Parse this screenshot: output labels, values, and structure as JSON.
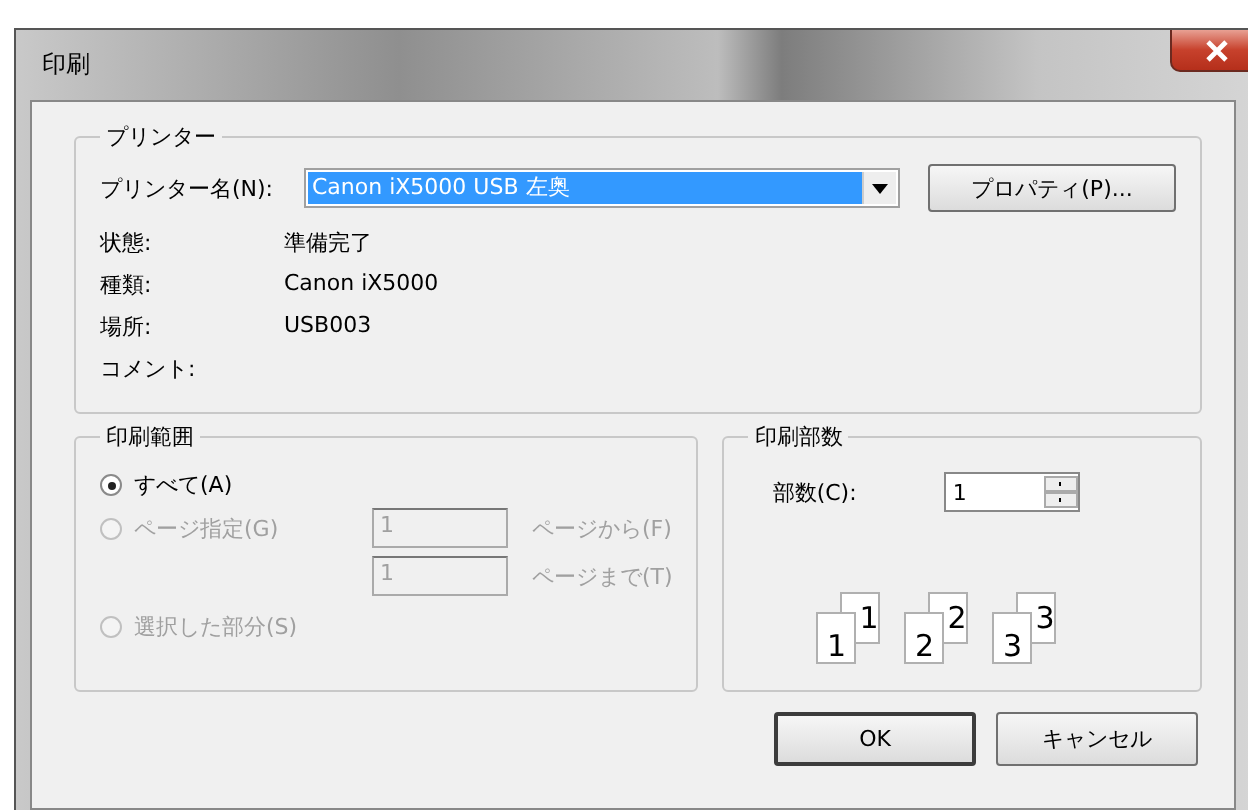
{
  "window": {
    "title": "印刷"
  },
  "printer": {
    "title": "プリンター",
    "name_label": "プリンター名(N):",
    "name_value": "Canon iX5000 USB 左奥",
    "properties_button": "プロパティ(P)...",
    "info": [
      {
        "label": "状態:",
        "value": "準備完了"
      },
      {
        "label": "種類:",
        "value": "Canon iX5000"
      },
      {
        "label": "場所:",
        "value": "USB003"
      },
      {
        "label": "コメント:"
      }
    ]
  },
  "range": {
    "title": "印刷範囲",
    "options": [
      {
        "label": "すべて(A)",
        "selected": true,
        "disabled": false
      },
      {
        "label": "ページ指定(G)",
        "selected": false,
        "disabled": true
      },
      {
        "label": "選択した部分(S)",
        "selected": false,
        "disabled": true
      }
    ],
    "from_value": "1",
    "from_label": "ページから(F)",
    "to_value": "1",
    "to_label": "ページまで(T)",
    "fields_disabled": true
  },
  "copies": {
    "title": "印刷部数",
    "label": "部数(C):",
    "value": "1",
    "collate_pages": [
      {
        "front": "1",
        "back": "1"
      },
      {
        "front": "2",
        "back": "2"
      },
      {
        "front": "3",
        "back": "3"
      }
    ]
  },
  "buttons": [
    {
      "label": "OK",
      "default": true
    },
    {
      "label": "キャンセル",
      "default": false
    }
  ]
}
